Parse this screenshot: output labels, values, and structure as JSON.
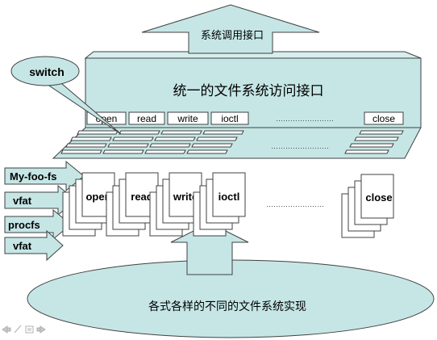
{
  "diagram": {
    "top_arrow_label": "系统调用接口",
    "interface_title": "统一的文件系统访问接口",
    "switch_label": "switch",
    "ops": [
      "open",
      "read",
      "write",
      "ioctl",
      "close"
    ],
    "dots": "……………………",
    "fs_labels": [
      "My-foo-fs",
      "vfat",
      "procfs",
      "vfat"
    ],
    "bottom_label": "各式各样的不同的文件系统实现",
    "colors": {
      "fill": "#c6e6e6",
      "stroke": "#404040",
      "card": "#ffffff"
    },
    "footer_icons": [
      "back-icon",
      "pen-icon",
      "menu-icon",
      "forward-icon"
    ]
  }
}
